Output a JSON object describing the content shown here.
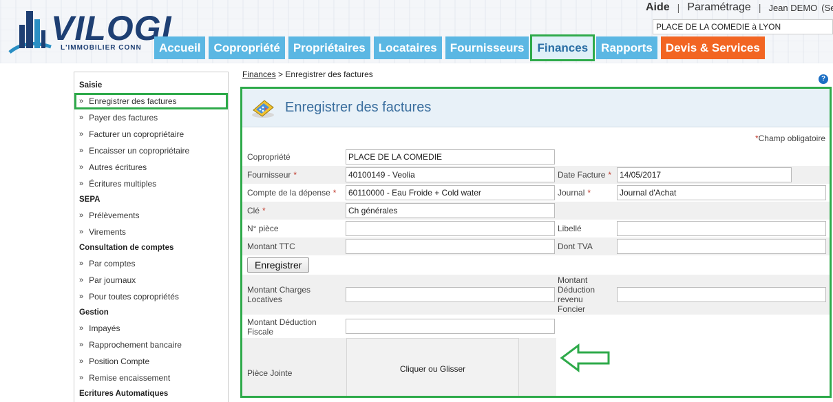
{
  "header": {
    "logo_text": "VILOGI",
    "logo_tagline": "L'IMMOBILIER CONN",
    "top_links": {
      "help": "Aide",
      "sep1": "|",
      "settings": "Paramétrage",
      "sep2": "|",
      "user": "Jean DEMO",
      "user_extra": "(Se"
    },
    "copro_selector_value": "PLACE DE LA COMEDIE à LYON"
  },
  "nav": {
    "tabs": [
      {
        "label": "Accueil",
        "active": false
      },
      {
        "label": "Copropriété",
        "active": false
      },
      {
        "label": "Propriétaires",
        "active": false
      },
      {
        "label": "Locataires",
        "active": false
      },
      {
        "label": "Fournisseurs",
        "active": false
      },
      {
        "label": "Finances",
        "active": true
      },
      {
        "label": "Rapports",
        "active": false
      },
      {
        "label": "Devis & Services",
        "active": false
      }
    ]
  },
  "sidebar": {
    "bullet": "»",
    "sections": [
      {
        "title": "Saisie",
        "items": [
          "Enregistrer des factures",
          "Payer des factures",
          "Facturer un copropriétaire",
          "Encaisser un copropriétaire",
          "Autres écritures",
          "Écritures multiples"
        ]
      },
      {
        "title": "SEPA",
        "items": [
          "Prélèvements",
          "Virements"
        ]
      },
      {
        "title": "Consultation de comptes",
        "items": [
          "Par comptes",
          "Par journaux",
          "Pour toutes copropriétés"
        ]
      },
      {
        "title": "Gestion",
        "items": [
          "Impayés",
          "Rapprochement bancaire",
          "Position Compte",
          "Remise encaissement"
        ]
      },
      {
        "title": "Ecritures Automatiques",
        "items": []
      }
    ]
  },
  "breadcrumb": {
    "parent": "Finances",
    "separator": ">",
    "current": "Enregistrer des factures"
  },
  "help_icon": "?",
  "form": {
    "title": "Enregistrer des factures",
    "required_star": "*",
    "required_note": "Champ obligatoire",
    "copropriete": {
      "label": "Copropriété",
      "value": "PLACE DE LA COMEDIE"
    },
    "fournisseur": {
      "label": "Fournisseur",
      "value": "40100149 - Veolia"
    },
    "date_facture": {
      "label": "Date Facture",
      "value": "14/05/2017"
    },
    "compte_depense": {
      "label": "Compte de la dépense",
      "value": "60110000 - Eau Froide + Cold water"
    },
    "journal": {
      "label": "Journal",
      "value": "Journal d'Achat"
    },
    "cle": {
      "label": "Clé",
      "value": "Ch générales"
    },
    "num_piece": {
      "label": "N° pièce",
      "value": ""
    },
    "libelle": {
      "label": "Libellé",
      "value": ""
    },
    "montant_ttc": {
      "label": "Montant TTC",
      "value": ""
    },
    "dont_tva": {
      "label": "Dont TVA",
      "value": ""
    },
    "save_button": "Enregistrer",
    "charges_locatives": {
      "label_line1": "Montant Charges",
      "label_line2": "Locatives",
      "value": ""
    },
    "deduction_revenu": {
      "label_line1": "Montant",
      "label_line2": "Déduction",
      "label_line3": "revenu",
      "label_line4": "Foncier",
      "value": ""
    },
    "deduction_fiscale": {
      "label_line1": "Montant Déduction",
      "label_line2": "Fiscale",
      "value": ""
    },
    "piece_jointe": {
      "label": "Pièce Jointe",
      "dropzone": "Cliquer ou Glisser"
    }
  },
  "colors": {
    "nav_blue": "#5bb7e3",
    "nav_orange": "#f26522",
    "highlight_green": "#2eaa4a",
    "title_blue": "#3a6e9e",
    "required_red": "#c0392b"
  }
}
